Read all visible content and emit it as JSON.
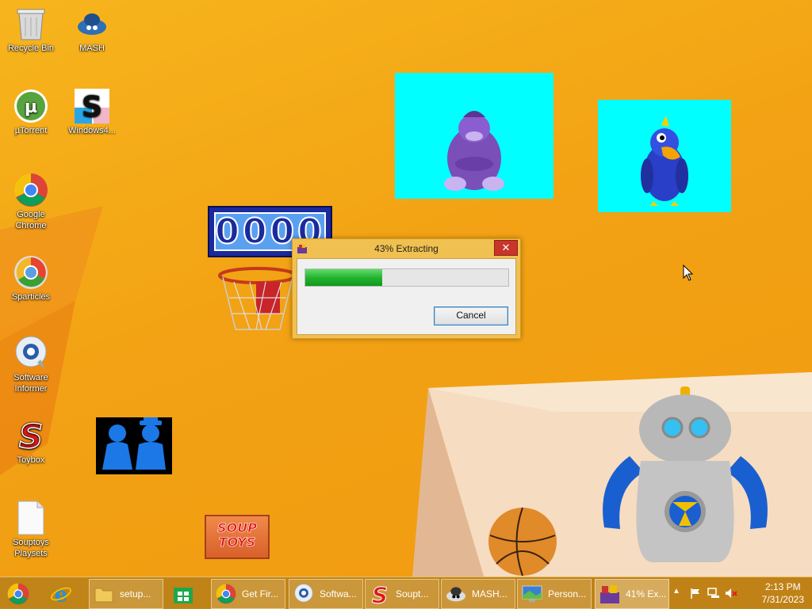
{
  "desktop": {
    "icons": [
      {
        "label": "Recycle Bin",
        "icon": "recycle-bin-icon"
      },
      {
        "label": "MASH",
        "icon": "mash-icon"
      },
      {
        "label": "µTorrent",
        "icon": "utorrent-icon"
      },
      {
        "label": "Windows4...",
        "icon": "windows4-icon"
      },
      {
        "label": "Google Chrome",
        "icon": "chrome-icon"
      },
      {
        "label": "Sparticles",
        "icon": "sparticles-icon"
      },
      {
        "label": "Software Informer",
        "icon": "software-informer-icon"
      },
      {
        "label": "Toybox",
        "icon": "toybox-icon"
      },
      {
        "label": "Souptoys Playsets",
        "icon": "document-icon"
      }
    ],
    "scoreboard": "0000",
    "soup_toys_logo": "SOUP TOYS"
  },
  "dialog": {
    "title": "43% Extracting",
    "progress": 0.38,
    "cancel_label": "Cancel",
    "close_symbol": "✕"
  },
  "taskbar": {
    "items": [
      {
        "label": "",
        "icon": "chrome-pinned-icon"
      },
      {
        "label": "",
        "icon": "internet-explorer-icon"
      },
      {
        "label": "setup...",
        "icon": "folder-icon"
      },
      {
        "label": "",
        "icon": "store-icon"
      },
      {
        "label": "Get Fir...",
        "icon": "chrome-icon"
      },
      {
        "label": "Softwa...",
        "icon": "software-informer-icon"
      },
      {
        "label": "Soupt...",
        "icon": "souptoys-icon"
      },
      {
        "label": "MASH...",
        "icon": "mash-icon"
      },
      {
        "label": "Person...",
        "icon": "personalize-icon"
      },
      {
        "label": "41% Ex...",
        "icon": "extract-icon"
      }
    ],
    "clock_time": "2:13 PM",
    "clock_date": "7/31/2023"
  },
  "colors": {
    "wallpaper": "#f5a918",
    "toy_bg": "#00ffff",
    "accent": "#3c7fb1"
  }
}
